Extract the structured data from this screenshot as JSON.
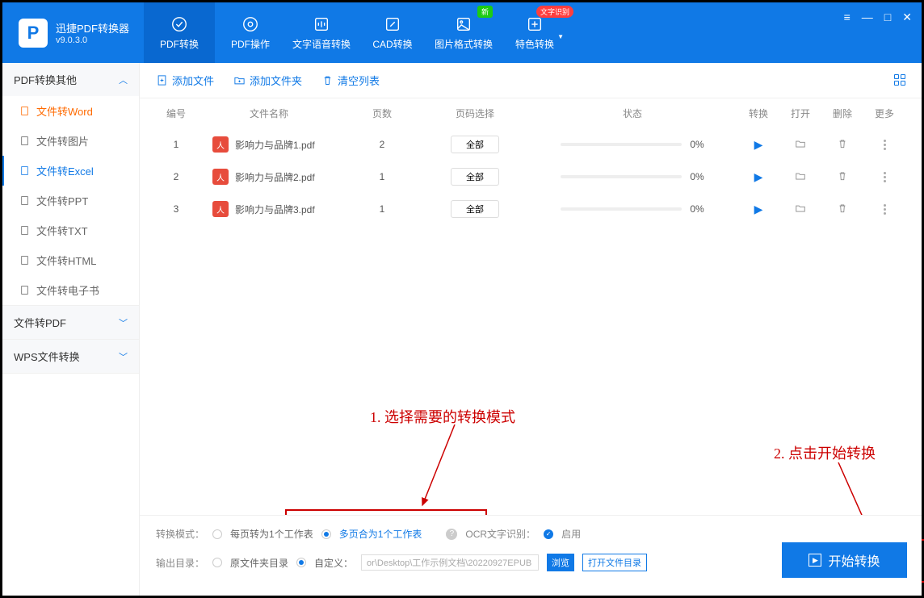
{
  "app": {
    "title": "迅捷PDF转换器",
    "version": "v9.0.3.0"
  },
  "nav": {
    "tabs": [
      {
        "label": "PDF转换"
      },
      {
        "label": "PDF操作"
      },
      {
        "label": "文字语音转换"
      },
      {
        "label": "CAD转换"
      },
      {
        "label": "图片格式转换",
        "badge_new": "新"
      },
      {
        "label": "特色转换",
        "badge_text": "文字识别"
      }
    ]
  },
  "sidebar": {
    "sections": [
      {
        "header": "PDF转换其他",
        "expanded": true,
        "items": [
          {
            "label": "文件转Word"
          },
          {
            "label": "文件转图片"
          },
          {
            "label": "文件转Excel"
          },
          {
            "label": "文件转PPT"
          },
          {
            "label": "文件转TXT"
          },
          {
            "label": "文件转HTML"
          },
          {
            "label": "文件转电子书"
          }
        ]
      },
      {
        "header": "文件转PDF",
        "expanded": false
      },
      {
        "header": "WPS文件转换",
        "expanded": false
      }
    ]
  },
  "toolbar": {
    "add_file": "添加文件",
    "add_folder": "添加文件夹",
    "clear_list": "清空列表"
  },
  "columns": {
    "index": "编号",
    "filename": "文件名称",
    "pages": "页数",
    "page_select": "页码选择",
    "status": "状态",
    "convert": "转换",
    "open": "打开",
    "delete": "删除",
    "more": "更多"
  },
  "rows": [
    {
      "index": "1",
      "name": "影响力与品牌1.pdf",
      "pages": "2",
      "page_sel": "全部",
      "progress": "0%"
    },
    {
      "index": "2",
      "name": "影响力与品牌2.pdf",
      "pages": "1",
      "page_sel": "全部",
      "progress": "0%"
    },
    {
      "index": "3",
      "name": "影响力与品牌3.pdf",
      "pages": "1",
      "page_sel": "全部",
      "progress": "0%"
    }
  ],
  "bottom": {
    "mode_label": "转换模式：",
    "mode_opt1": "每页转为1个工作表",
    "mode_opt2": "多页合为1个工作表",
    "ocr_label": "OCR文字识别：",
    "ocr_enable": "启用",
    "output_label": "输出目录：",
    "out_opt1": "原文件夹目录",
    "out_opt2": "自定义：",
    "path_value": "or\\Desktop\\工作示例文档\\20220927EPUB",
    "browse": "浏览",
    "open_folder": "打开文件目录"
  },
  "start_button": "开始转换",
  "annotations": {
    "a1": "1. 选择需要的转换模式",
    "a2": "2. 点击开始转换"
  }
}
